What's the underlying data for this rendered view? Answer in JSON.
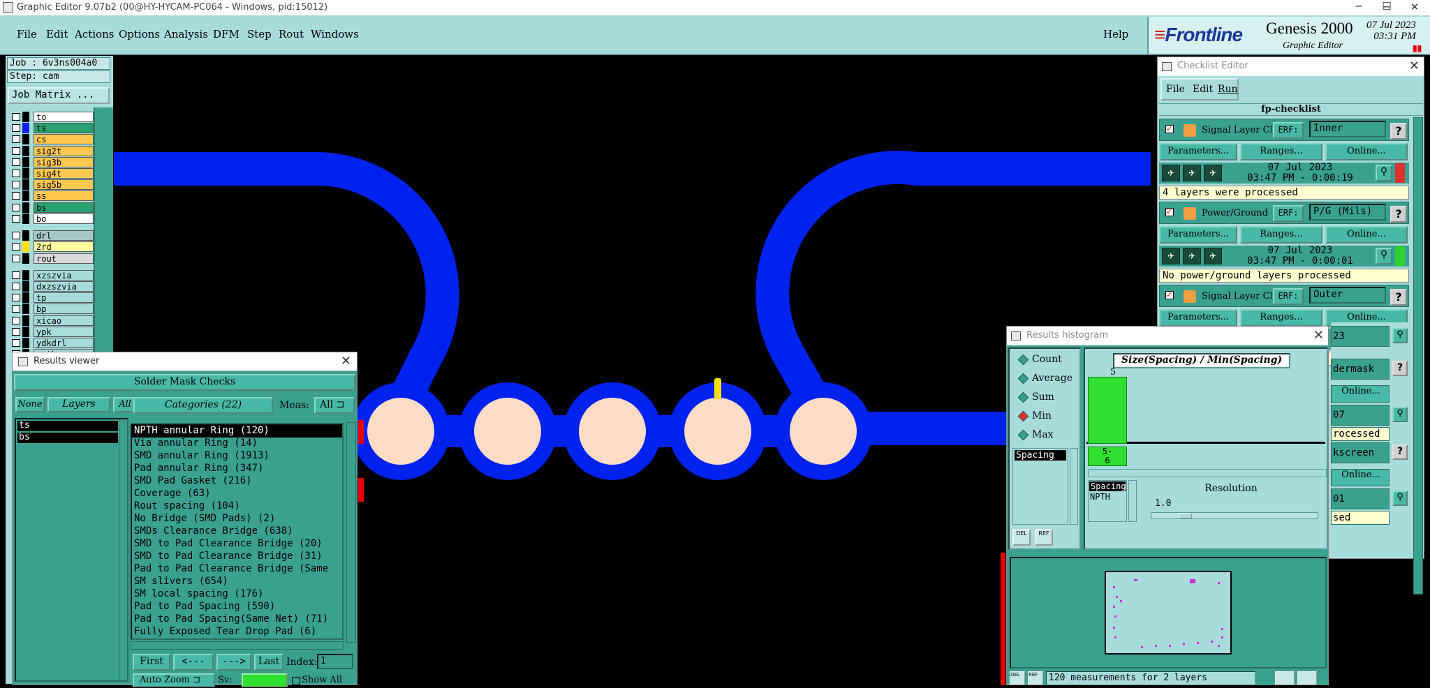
{
  "window": {
    "title": "Graphic Editor 9.07b2 (00@HY-HYCAM-PC064 - Windows, pid:15012)",
    "min": "─",
    "max": "☐",
    "close": "✕"
  },
  "menu": {
    "file": "File",
    "edit": "Edit",
    "actions": "Actions",
    "options": "Options",
    "analysis": "Analysis",
    "dfm": "DFM",
    "step": "Step",
    "rout": "Rout",
    "windows": "Windows",
    "help": "Help"
  },
  "brand": {
    "logo": "Frontline",
    "product": "Genesis 2000",
    "sub": "Graphic Editor",
    "date": "07 Jul 2023",
    "time": "03:31 PM"
  },
  "left": {
    "job": "Job : 6v3ns004a0",
    "step": "Step: cam",
    "job_matrix": "Job Matrix ...",
    "layers": [
      {
        "name": "to",
        "color": "#ffffff"
      },
      {
        "name": "ts",
        "color": "#2aa070"
      },
      {
        "name": "cs",
        "color": "#ffc850"
      },
      {
        "name": "sig2t",
        "color": "#ffc850"
      },
      {
        "name": "sig3b",
        "color": "#ffc850"
      },
      {
        "name": "sig4t",
        "color": "#ffc850"
      },
      {
        "name": "sig5b",
        "color": "#ffc850"
      },
      {
        "name": "ss",
        "color": "#ffc850"
      },
      {
        "name": "bs",
        "color": "#2aa070"
      },
      {
        "name": "bo",
        "color": "#ffffff"
      },
      {
        "name": "drl",
        "color": "#a8c8c8"
      },
      {
        "name": "2rd",
        "color": "#ffffa0"
      },
      {
        "name": "rout",
        "color": "#d8d8d8"
      },
      {
        "name": "xzszvia",
        "color": "#a8dcdc"
      },
      {
        "name": "dxzszvia",
        "color": "#a8dcdc"
      },
      {
        "name": "tp",
        "color": "#a8dcdc"
      },
      {
        "name": "bp",
        "color": "#a8dcdc"
      },
      {
        "name": "xicao",
        "color": "#a8dcdc"
      },
      {
        "name": "ypk",
        "color": "#a8dcdc"
      },
      {
        "name": "ydkdrl",
        "color": "#a8dcdc"
      },
      {
        "name": "npth",
        "color": "#a8dcdc"
      }
    ]
  },
  "results_viewer": {
    "title": "Results viewer",
    "header": "Solder Mask Checks",
    "none": "None",
    "layers": "Layers",
    "all": "All",
    "categories": "Categories (22)",
    "meas": "Meas:",
    "meas_val": "All",
    "layer_list": [
      "ts",
      "bs"
    ],
    "cat_list": [
      "NPTH annular Ring (120)",
      "Via annular Ring (14)",
      "SMD annular Ring (1913)",
      "Pad annular Ring (347)",
      "SMD Pad Gasket (216)",
      "Coverage (63)",
      "Rout spacing (104)",
      "No Bridge (SMD Pads) (2)",
      "SMDs Clearance Bridge (638)",
      "SMD to Pad Clearance Bridge (20)",
      "SMD to Pad Clearance Bridge (31)",
      "Pad to Pad Clearance Bridge (Same",
      "SM slivers (654)",
      "SM local spacing (176)",
      "Pad to Pad Spacing (590)",
      "Pad to Pad Spacing(Same Net) (71)",
      "Fully Exposed Tear Drop Pad (6)"
    ],
    "first": "First",
    "prev": "<---",
    "next": "--->",
    "last": "Last",
    "index": "Index:",
    "index_val": "1",
    "auto_zoom": "Auto Zoom",
    "sv": "Sv:",
    "show_all": "Show All"
  },
  "checklist": {
    "title": "Checklist Editor",
    "file": "File",
    "edit": "Edit",
    "run": "Run",
    "name": "fp-checklist",
    "params": "Parameters...",
    "ranges": "Ranges...",
    "online": "Online...",
    "erf": "ERF:",
    "items": [
      {
        "name": "Signal Layer Ch",
        "erf": "Inner",
        "date": "07 Jul 2023",
        "time": "03:47 PM - 0:00:19",
        "msg": "4 layers were processed",
        "status": "#e03030"
      },
      {
        "name": "Power/Ground C",
        "erf": "P/G (Mils)",
        "date": "07 Jul 2023",
        "time": "03:47 PM - 0:00:01",
        "msg": "No power/ground layers processed",
        "status": "#30d030"
      },
      {
        "name": "Signal Layer Ch",
        "erf": "Outer",
        "date": "",
        "time": "",
        "msg": "",
        "status": "#e03030"
      }
    ],
    "partial": [
      "23",
      "dermask",
      "07",
      "rocessed",
      "kscreen",
      "01",
      "sed"
    ]
  },
  "histogram": {
    "title": "Results histogram",
    "modes": [
      "Count",
      "Average",
      "Sum",
      "Min",
      "Max"
    ],
    "selected": "Min",
    "chart_title": "Size(Spacing) / Min(Spacing)",
    "bar_label": "5",
    "range_label": "5-\n6",
    "spacing": "Spacing",
    "npth": "NPTH",
    "resolution": "Resolution",
    "res_val": "1.0",
    "footer": "120 measurements for 2 layers"
  }
}
